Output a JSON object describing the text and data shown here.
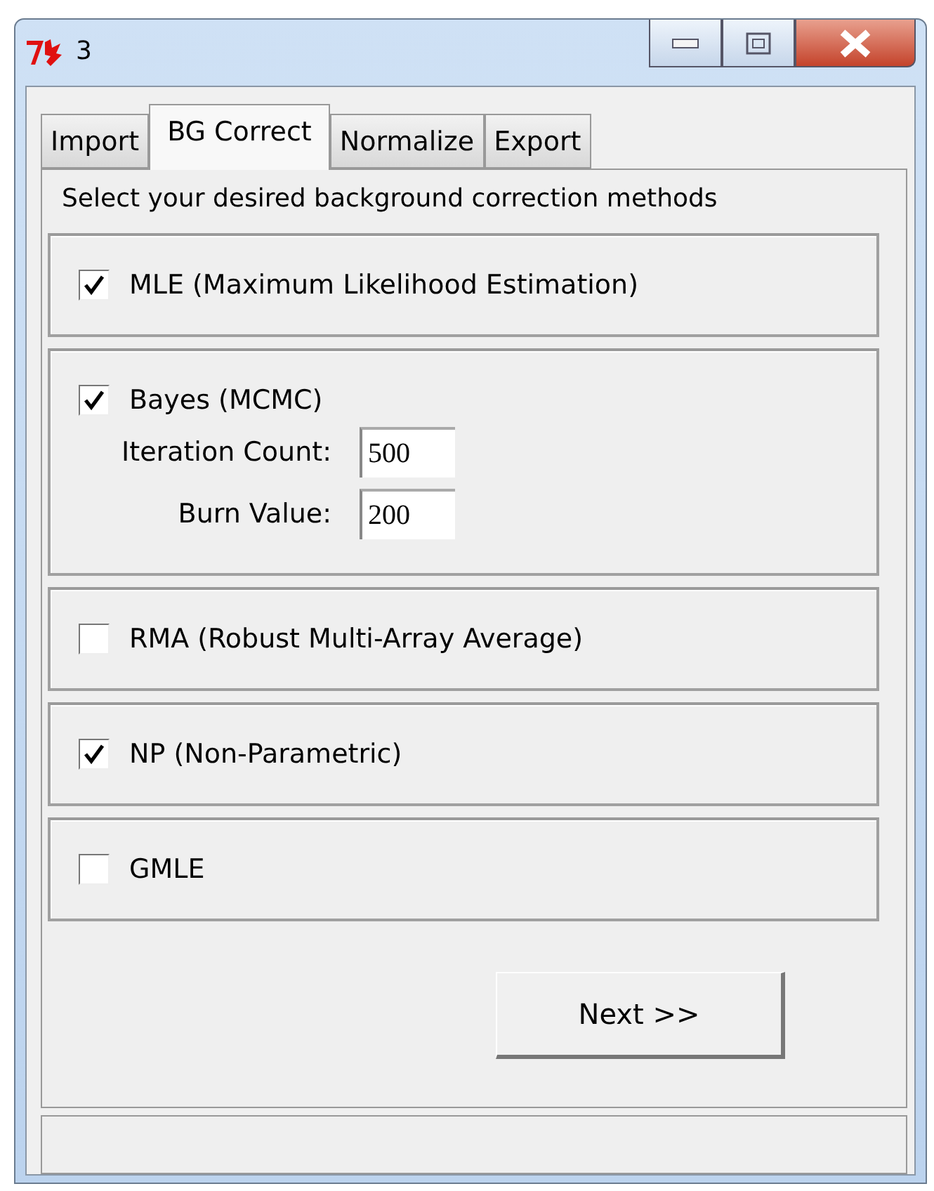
{
  "window": {
    "title": "3"
  },
  "tabs": [
    {
      "label": "Import",
      "selected": false
    },
    {
      "label": "BG Correct",
      "selected": true
    },
    {
      "label": "Normalize",
      "selected": false
    },
    {
      "label": "Export",
      "selected": false
    }
  ],
  "instruction": "Select your desired background correction methods",
  "methods": [
    {
      "label": "MLE (Maximum Likelihood Estimation)",
      "checked": true
    },
    {
      "label": "Bayes (MCMC)",
      "checked": true,
      "fields": [
        {
          "label": "Iteration Count:",
          "value": "500"
        },
        {
          "label": "Burn Value:",
          "value": "200"
        }
      ]
    },
    {
      "label": "RMA (Robust Multi-Array Average)",
      "checked": false
    },
    {
      "label": "NP (Non-Parametric)",
      "checked": true
    },
    {
      "label": "GMLE",
      "checked": false
    }
  ],
  "next_button": "Next >>"
}
